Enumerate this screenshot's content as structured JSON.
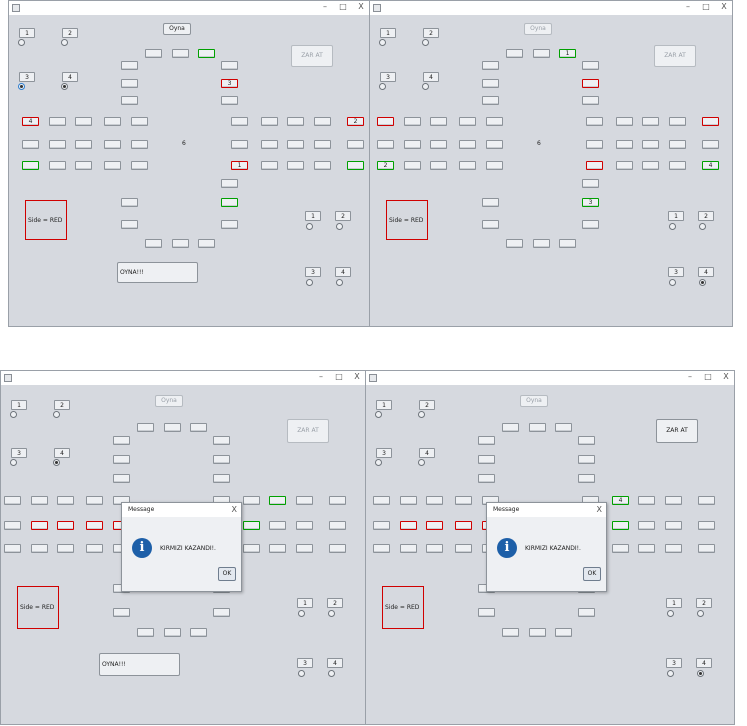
{
  "panels": [
    {
      "id": "p1",
      "oyna": {
        "label": "Oyna",
        "disabled": false
      },
      "zar": {
        "label": "ZAR AT",
        "disabled": true
      },
      "dice": "6",
      "side": "Side = RED",
      "bigbtn": "OYNA!!!",
      "cells": [
        {
          "k": "l1",
          "t": "4"
        },
        {
          "k": "l3",
          "t": ""
        },
        {
          "k": "r1",
          "t": "2"
        },
        {
          "k": "r3",
          "t": ""
        },
        {
          "k": "t1",
          "t": "3"
        },
        {
          "k": "b1",
          "t": "1"
        },
        {
          "k": "b3",
          "t": ""
        },
        {
          "k": "tt",
          "t": ""
        }
      ],
      "radios": [
        false,
        false,
        true,
        true,
        false,
        false,
        false,
        false
      ]
    },
    {
      "id": "p2",
      "oyna": {
        "label": "Oyna",
        "disabled": true
      },
      "zar": {
        "label": "ZAR AT",
        "disabled": true
      },
      "dice": "6",
      "side": "Side = RED",
      "bigbtn": "",
      "cells": [
        {
          "k": "l1",
          "t": ""
        },
        {
          "k": "l3",
          "t": "2"
        },
        {
          "k": "r1",
          "t": ""
        },
        {
          "k": "r3",
          "t": "4"
        },
        {
          "k": "t1",
          "t": ""
        },
        {
          "k": "b1",
          "t": ""
        },
        {
          "k": "b3",
          "t": "3"
        },
        {
          "k": "tt",
          "t": "1"
        }
      ],
      "radios": [
        false,
        false,
        false,
        false,
        false,
        false,
        false,
        true
      ]
    },
    {
      "id": "p3",
      "oyna": {
        "label": "Oyna",
        "disabled": true
      },
      "zar": {
        "label": "ZAR AT",
        "disabled": true
      },
      "dice": "",
      "side": "Side = RED",
      "bigbtn": "OYNA!!!",
      "radios": [
        false,
        false,
        false,
        true,
        false,
        false,
        false,
        false
      ]
    },
    {
      "id": "p4",
      "oyna": {
        "label": "Oyna",
        "disabled": true
      },
      "zar": {
        "label": "ZAR AT",
        "disabled": false
      },
      "dice": "",
      "side": "Side = RED",
      "bigbtn": "",
      "radios": [
        false,
        false,
        false,
        false,
        false,
        false,
        false,
        true
      ]
    }
  ],
  "player_numbers": [
    "1",
    "2",
    "3",
    "4"
  ],
  "dialog": {
    "title": "Message",
    "message": "KIRMIZI KAZANDI!.",
    "ok": "OK",
    "close": "X"
  },
  "window_controls": {
    "min": "–",
    "max": "□",
    "close": "X"
  },
  "p4_green_cell": "4",
  "colors": {
    "red": "#d00000",
    "green": "#00a000",
    "window_bg": "#d6d9df",
    "info_icon": "#1d5fa8"
  }
}
